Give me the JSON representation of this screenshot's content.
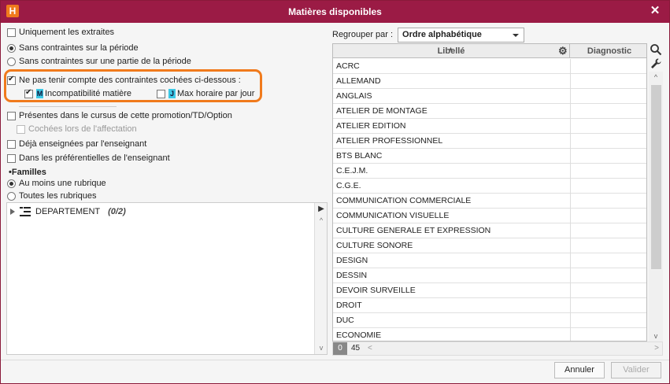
{
  "window": {
    "title": "Matières disponibles",
    "app_icon": "H",
    "close_glyph": "✕"
  },
  "filters": {
    "only_extracts": "Uniquement les extraites",
    "no_constraints_period": "Sans contraintes sur la période",
    "no_constraints_part": "Sans contraintes sur une partie de la période",
    "ignore_constraints": "Ne pas tenir compte des contraintes cochées ci-dessous :",
    "incompat_badge": "M",
    "incompat_label": "Incompatibilité matière",
    "max_hours_badge": "J",
    "max_hours_label": "Max horaire par jour",
    "present_in_cursus": "Présentes dans le cursus de cette promotion/TD/Option",
    "checked_on_assign": "Cochées lors de l'affectation",
    "taught_by_teacher": "Déjà enseignées par l'enseignant",
    "teacher_preferences": "Dans les préférentielles de l'enseignant"
  },
  "families": {
    "title": "•Familles",
    "at_least_one": "Au moins une rubrique",
    "all_rubrics": "Toutes les rubriques",
    "tree_item": "DEPARTEMENT",
    "tree_count": "(0/2)"
  },
  "grouping": {
    "label": "Regrouper par :",
    "value": "Ordre alphabétique"
  },
  "grid": {
    "col_label": "Libellé",
    "col_diag": "Diagnostic",
    "rows": [
      "ACRC",
      "ALLEMAND",
      "ANGLAIS",
      "ATELIER DE MONTAGE",
      "ATELIER EDITION",
      "ATELIER PROFESSIONNEL",
      "BTS BLANC",
      "C.E.J.M.",
      "C.G.E.",
      "COMMUNICATION COMMERCIALE",
      "COMMUNICATION VISUELLE",
      "CULTURE GENERALE ET EXPRESSION",
      "CULTURE SONORE",
      "DESIGN",
      "DESSIN",
      "DEVOIR SURVEILLE",
      "DROIT",
      "DUC",
      "ECONOMIE"
    ],
    "footer_selected": "0",
    "footer_total": "45"
  },
  "buttons": {
    "cancel": "Annuler",
    "validate": "Valider"
  },
  "colors": {
    "titlebar": "#9b1b45",
    "highlight": "#f07a1c",
    "badge": "#3cc8e6"
  }
}
